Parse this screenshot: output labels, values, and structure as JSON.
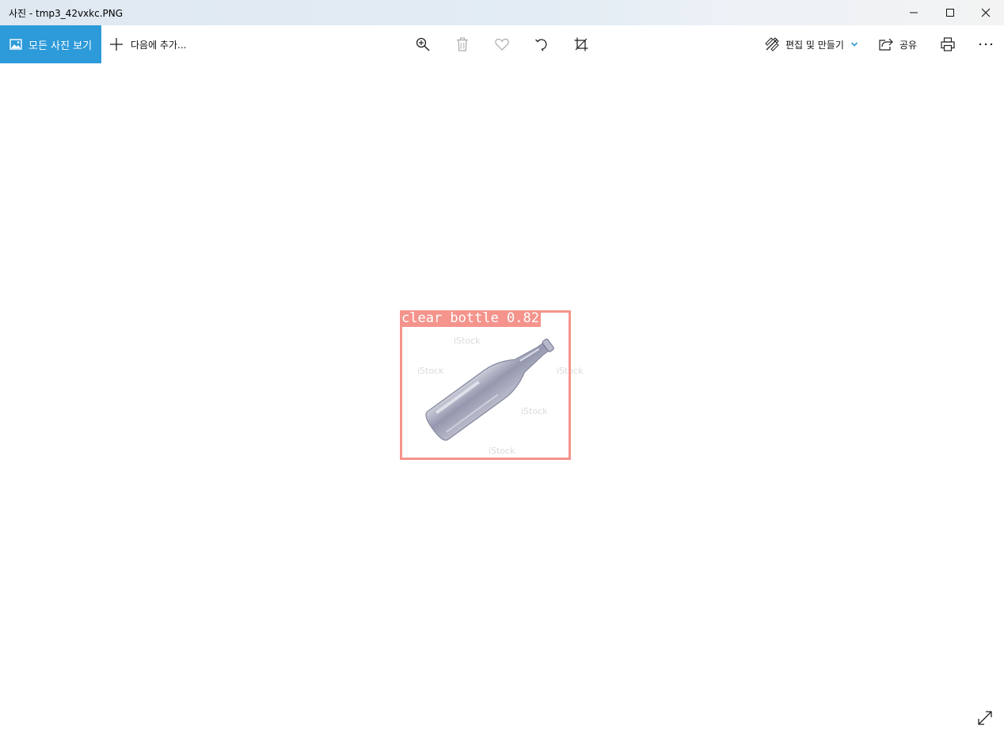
{
  "window": {
    "title": "사진 - tmp3_42vxkc.PNG",
    "minimize_icon": "minimize-icon",
    "maximize_icon": "maximize-icon",
    "close_icon": "close-icon"
  },
  "toolbar": {
    "all_photos_label": "모든 사진 보기",
    "add_to_label": "다음에 추가...",
    "zoom_icon": "zoom-in-icon",
    "delete_icon": "trash-icon",
    "favorite_icon": "heart-icon",
    "rotate_icon": "rotate-icon",
    "crop_icon": "crop-icon",
    "edit_create_label": "편집 및 만들기",
    "share_label": "공유",
    "print_icon": "print-icon",
    "more_icon": "more-icon"
  },
  "image": {
    "detection_label": "clear bottle 0.82",
    "watermark": "iStock"
  },
  "colors": {
    "accent": "#2d9ad9",
    "detection_box": "#f4948c"
  }
}
